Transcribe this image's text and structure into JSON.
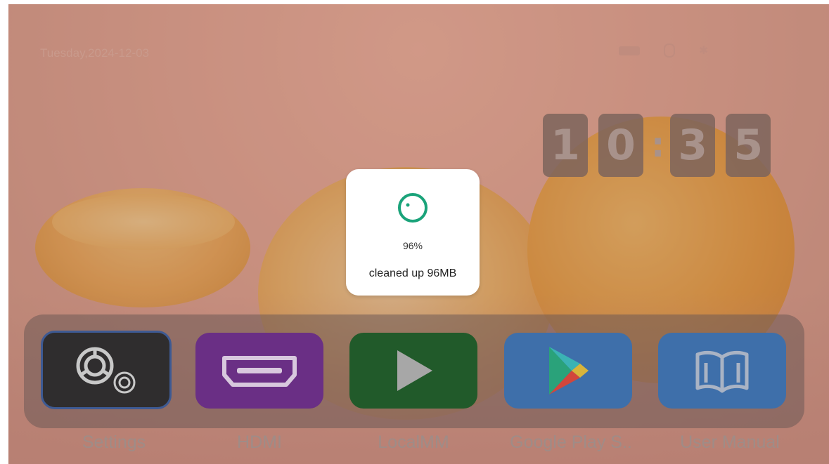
{
  "status_bar": {
    "date": "Tuesday,2024-12-03",
    "icons": [
      "keyboard-icon",
      "mouse-icon",
      "bluetooth-icon"
    ]
  },
  "clock": {
    "digits": [
      "1",
      "0",
      "3",
      "5"
    ],
    "separator": ":"
  },
  "dock": {
    "apps": [
      {
        "label": "Settings",
        "icon": "gear-icon",
        "selected": true
      },
      {
        "label": "HDMI",
        "icon": "hdmi-icon"
      },
      {
        "label": "LocalMM",
        "icon": "play-icon"
      },
      {
        "label": "Google Play S..",
        "icon": "google-play-icon"
      },
      {
        "label": "User Manual",
        "icon": "book-icon"
      }
    ]
  },
  "toast": {
    "icon": "cleanup-progress-icon",
    "percent": "96%",
    "message": "cleaned up 96MB"
  },
  "colors": {
    "toast_accent": "#1aa37a",
    "selection_border": "#3e5a93"
  }
}
